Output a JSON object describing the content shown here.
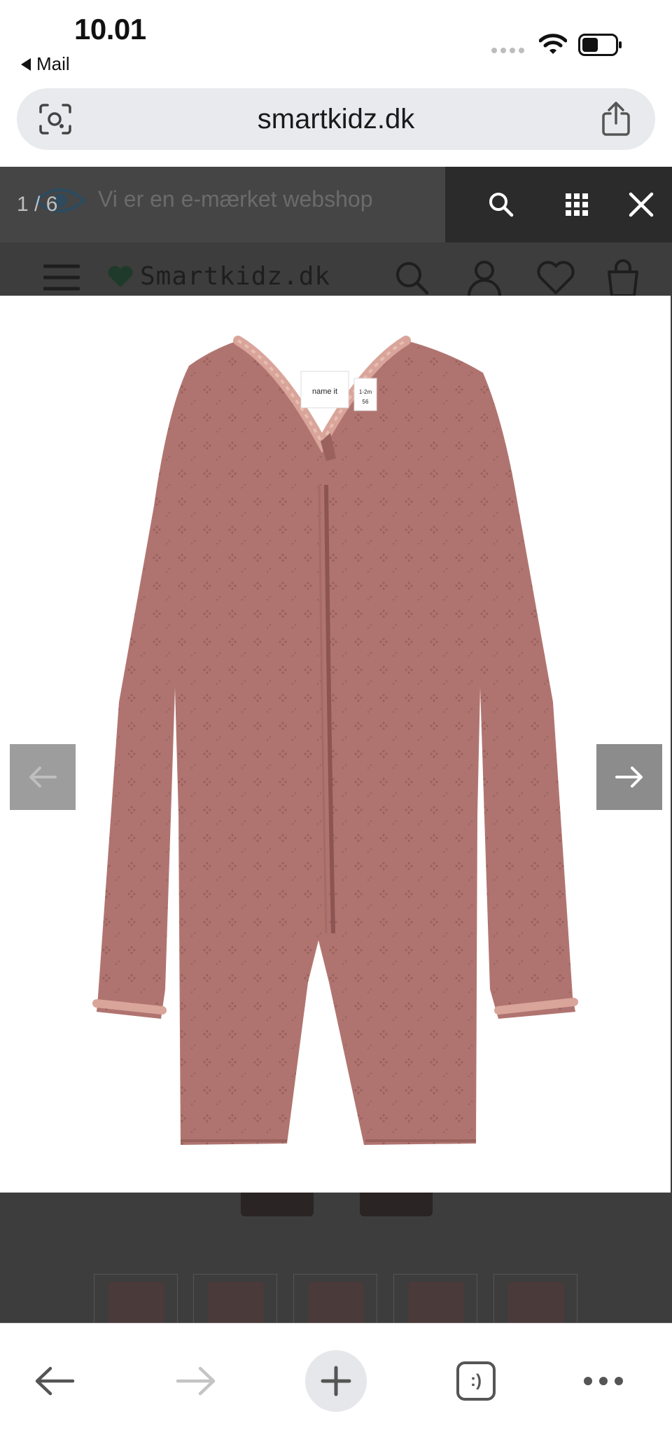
{
  "status_bar": {
    "time": "10.01",
    "back_app": "Mail"
  },
  "browser": {
    "url": "smartkidz.dk",
    "tabs_icon_text": ":)"
  },
  "site": {
    "promo_text": "Vi er en e-mærket webshop",
    "logo_text": "Smartkidz.dk"
  },
  "lightbox": {
    "counter": "1 / 6"
  },
  "product": {
    "label_brand": "name it",
    "label_size": "1-2m\n56",
    "color": "#b07470"
  },
  "colors": {
    "overlay": "#3d3d3d",
    "toolbar": "#2b2b2b",
    "url_bar": "#e8eaed",
    "arrow_bg": "#8c8c8c"
  },
  "icons": {
    "lens": "visual-search-icon",
    "share": "share-icon",
    "search": "search-icon",
    "grid": "grid-icon",
    "close": "close-icon",
    "menu": "hamburger-menu-icon",
    "user": "user-icon",
    "heart": "heart-icon",
    "bag": "shopping-bag-icon",
    "prev": "arrow-left-icon",
    "next": "arrow-right-icon"
  }
}
